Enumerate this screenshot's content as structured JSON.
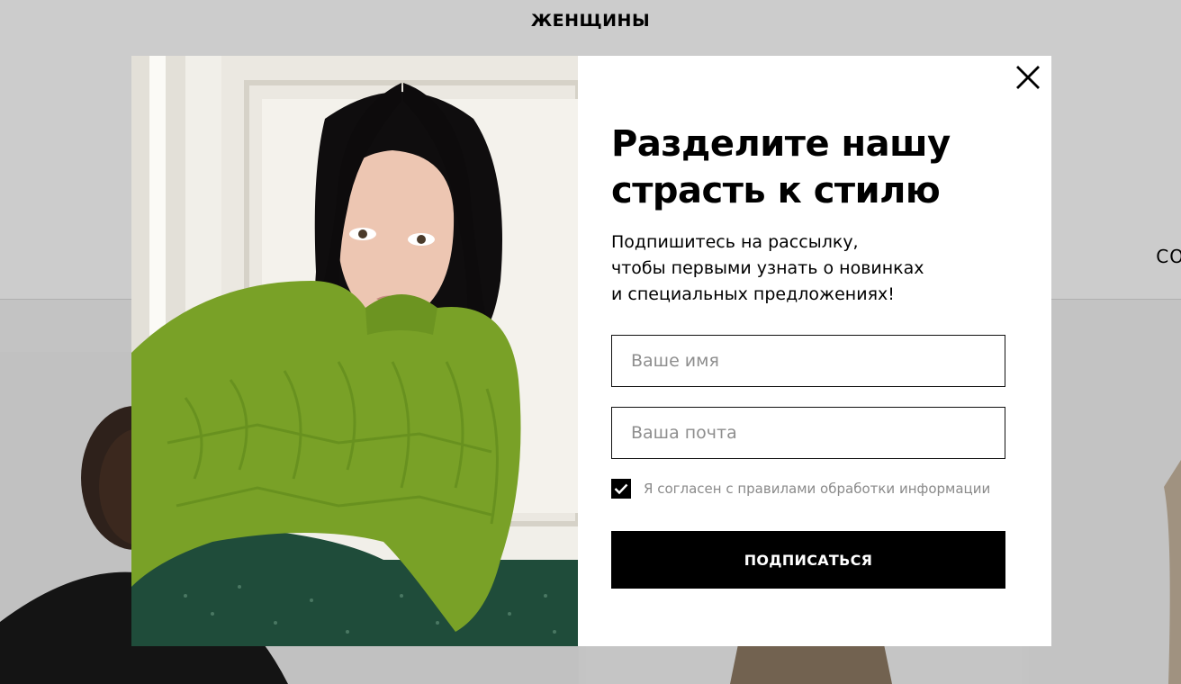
{
  "background": {
    "nav_title": "ЖЕНЩИНЫ",
    "nav_cut_label": "CO"
  },
  "modal": {
    "title_line1": "Разделите нашу",
    "title_line2": "страсть к стилю",
    "subtitle_line1": "Подпишитесь на рассылку,",
    "subtitle_line2": "чтобы первыми узнать о новинках",
    "subtitle_line3": "и специальных предложениях!",
    "name_placeholder": "Ваше имя",
    "email_placeholder": "Ваша почта",
    "consent_label": "Я согласен с правилами обработки информации",
    "consent_checked": true,
    "submit_label": "ПОДПИСАТЬСЯ",
    "close_icon": "close-icon",
    "photo_description_icon": "promo-photo"
  },
  "colors": {
    "button": "#000000",
    "overlay": "rgba(0,0,0,0.2)",
    "sweater": "#7aa128"
  }
}
